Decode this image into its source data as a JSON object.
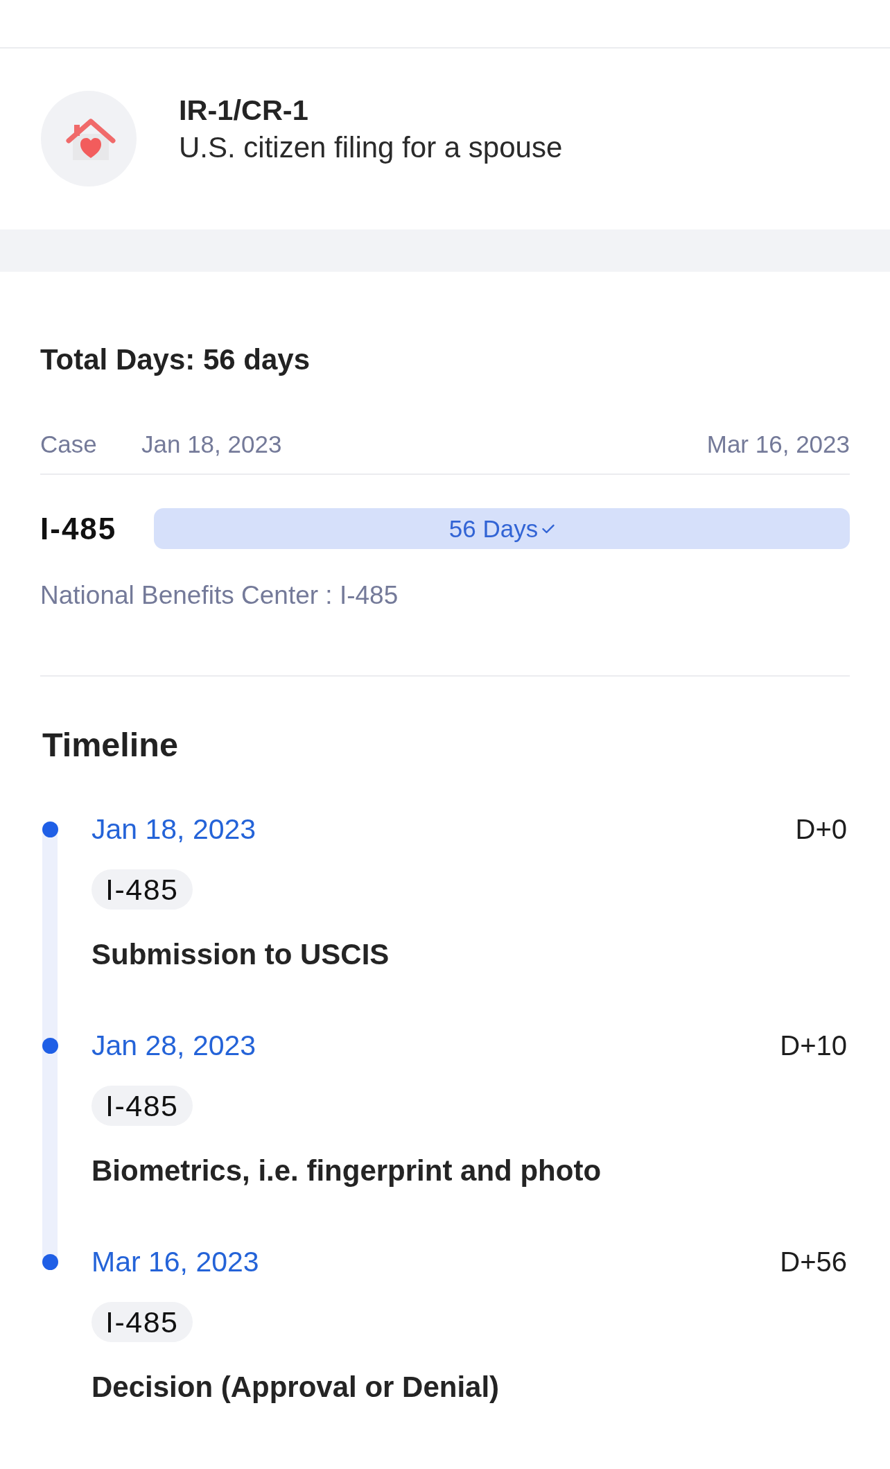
{
  "plan": {
    "title": "IR-1/CR-1",
    "subtitle": "U.S. citizen filing for a spouse"
  },
  "summary": {
    "total": "Total Days: 56 days",
    "axis": {
      "label": "Case",
      "start": "Jan 18, 2023",
      "end": "Mar 16, 2023"
    },
    "bars": [
      {
        "label": "I-485",
        "text": "56 Days",
        "completed": true
      }
    ],
    "note": "National Benefits Center : I-485"
  },
  "timeline": {
    "title": "Timeline",
    "events": [
      {
        "date": "Jan 18, 2023",
        "offset": "D+0",
        "tag": "I-485",
        "title": "Submission to USCIS"
      },
      {
        "date": "Jan 28, 2023",
        "offset": "D+10",
        "tag": "I-485",
        "title": "Biometrics, i.e. fingerprint and photo"
      },
      {
        "date": "Mar 16, 2023",
        "offset": "D+56",
        "tag": "I-485",
        "title": "Decision (Approval or Denial)"
      }
    ]
  }
}
